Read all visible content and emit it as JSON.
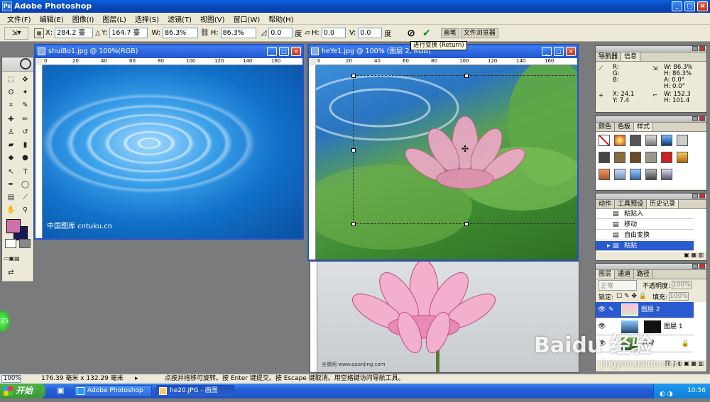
{
  "app": {
    "title": "Adobe Photoshop",
    "icon": "photoshop-icon"
  },
  "window_buttons": {
    "minimize": "_",
    "maximize": "□",
    "close": "×"
  },
  "menu": [
    "文件(F)",
    "编辑(E)",
    "图像(I)",
    "图层(L)",
    "选择(S)",
    "滤镜(T)",
    "视图(V)",
    "窗口(W)",
    "帮助(H)"
  ],
  "options": {
    "x_label": "X:",
    "x_value": "284.2 臺",
    "y_label": "Y:",
    "y_value": "164.7 臺",
    "w_label": "W:",
    "w_value": "86.3%",
    "h_label": "H:",
    "h_value": "86.3%",
    "rot_value": "0.0",
    "rot_unit": "度",
    "hs_label": "H:",
    "hs_value": "0.0",
    "vs_label": "V:",
    "vs_value": "0.0",
    "skew_unit": "度",
    "tabs": [
      "画笔",
      "文件浏览器"
    ]
  },
  "tooltip": "进行变换 (Return)",
  "doc1": {
    "title": "shuiBo1.jpg @ 100%(RGB)",
    "watermark": "中国图库 cntuku.cn",
    "ruler": [
      "0",
      "20",
      "40",
      "60",
      "80",
      "100",
      "120",
      "140",
      "160"
    ]
  },
  "doc2": {
    "title": "heYe1.jpg @ 100% (图层 2, RGB)",
    "ruler": [
      "0",
      "20",
      "40",
      "60",
      "80",
      "100",
      "120",
      "140",
      "160"
    ],
    "bottom_text": "全景网 www.quanjing.com"
  },
  "navigator": {
    "tabs": [
      "导航器",
      "信息"
    ],
    "r": "R:",
    "g": "G:",
    "b": "B:",
    "w1": "W: 86.3%",
    "h1": "H: 86.3%",
    "a1": "A: 0.0°",
    "b1": "H: 0.0°",
    "x": "X: 24.1",
    "y": "Y: 7.4",
    "w2": "W: 152.3",
    "h2": "H: 101.4"
  },
  "styles_panel": {
    "tabs": [
      "颜色",
      "色板",
      "样式"
    ]
  },
  "history_panel": {
    "tabs": [
      "动作",
      "工具预设",
      "历史记录"
    ],
    "items": [
      "粘贴入",
      "移动",
      "自由变换",
      "粘贴"
    ]
  },
  "layers_panel": {
    "tabs": [
      "图层",
      "通道",
      "路径"
    ],
    "blend_mode": "正常",
    "opacity_label": "不透明度:",
    "opacity_value": "100%",
    "lock_label": "锁定:",
    "fill_label": "填充:",
    "fill_value": "100%",
    "layers": [
      "图层 2",
      "图层 1",
      "背景"
    ]
  },
  "status": {
    "zoom": "100%",
    "size": "176.39 毫米 x 132.29 毫米",
    "hint": "点按并拖移可旋转。按 Enter 键提交。按 Escape 键取消。用空格键访问导航工具。"
  },
  "taskbar": {
    "start": "开始",
    "tasks": [
      "Adobe Photoshop",
      "he20.JPG - 画图"
    ],
    "clock": "10:56"
  },
  "badge": "25",
  "watermark": {
    "logo": "Baidu 经验",
    "url": "jingyan.baidu.com"
  },
  "colors": {
    "foreground": "#d070a8",
    "background": "#1a1a5a",
    "accent": "#2353c8"
  }
}
